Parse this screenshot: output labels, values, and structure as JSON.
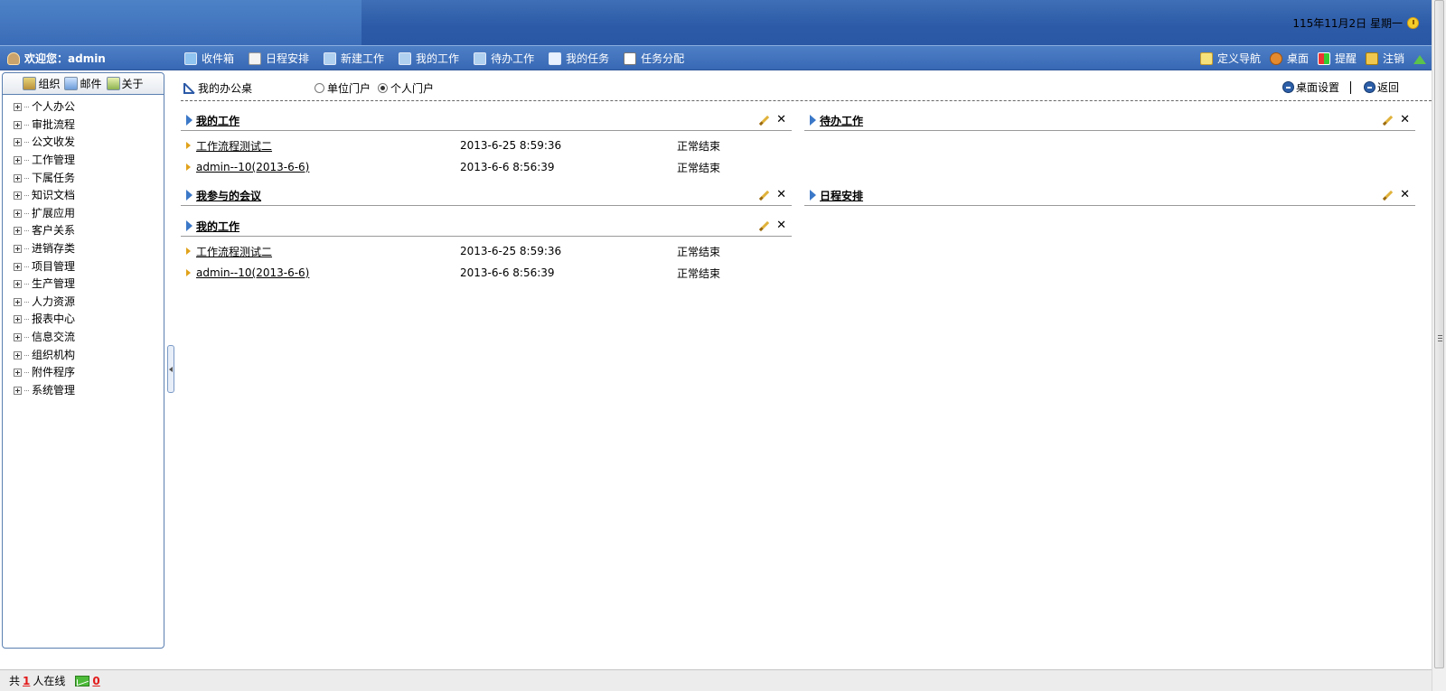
{
  "header": {
    "date": "115年11月2日 星期一"
  },
  "nav": {
    "welcome": "欢迎您：admin",
    "menu": [
      {
        "label": "收件箱",
        "icon": "inbox-icon"
      },
      {
        "label": "日程安排",
        "icon": "calendar-icon"
      },
      {
        "label": "新建工作",
        "icon": "new-work-icon"
      },
      {
        "label": "我的工作",
        "icon": "my-work-icon"
      },
      {
        "label": "待办工作",
        "icon": "todo-work-icon"
      },
      {
        "label": "我的任务",
        "icon": "my-task-icon"
      },
      {
        "label": "任务分配",
        "icon": "task-assign-icon"
      }
    ],
    "right": [
      {
        "label": "定义导航",
        "icon": "define-nav-icon"
      },
      {
        "label": "桌面",
        "icon": "desktop-icon"
      },
      {
        "label": "提醒",
        "icon": "remind-icon"
      },
      {
        "label": "注销",
        "icon": "logout-icon"
      }
    ]
  },
  "sidebar": {
    "tabs": [
      {
        "label": "组织",
        "icon": "org-icon"
      },
      {
        "label": "邮件",
        "icon": "mail-icon"
      },
      {
        "label": "关于",
        "icon": "about-icon"
      }
    ],
    "items": [
      "个人办公",
      "审批流程",
      "公文收发",
      "工作管理",
      "下属任务",
      "知识文档",
      "扩展应用",
      "客户关系",
      "进销存类",
      "项目管理",
      "生产管理",
      "人力资源",
      "报表中心",
      "信息交流",
      "组织机构",
      "附件程序",
      "系统管理"
    ]
  },
  "toolbar": {
    "desk_label": "我的办公桌",
    "radio_unit": "单位门户",
    "radio_personal": "个人门户",
    "desk_settings": "桌面设置",
    "back": "返回"
  },
  "panels": {
    "my_work_1": {
      "title": "我的工作",
      "rows": [
        {
          "title": "工作流程测试二",
          "time": "2013-6-25 8:59:36",
          "status": "正常结束"
        },
        {
          "title": "admin--10(2013-6-6)",
          "time": "2013-6-6 8:56:39",
          "status": "正常结束"
        }
      ]
    },
    "meetings": {
      "title": "我参与的会议"
    },
    "my_work_2": {
      "title": "我的工作",
      "rows": [
        {
          "title": "工作流程测试二",
          "time": "2013-6-25 8:59:36",
          "status": "正常结束"
        },
        {
          "title": "admin--10(2013-6-6)",
          "time": "2013-6-6 8:56:39",
          "status": "正常结束"
        }
      ]
    },
    "todo_work": {
      "title": "待办工作"
    },
    "schedule": {
      "title": "日程安排"
    }
  },
  "status": {
    "prefix": "共",
    "online_count": "1",
    "suffix": "人在线",
    "mail_count": "0"
  }
}
